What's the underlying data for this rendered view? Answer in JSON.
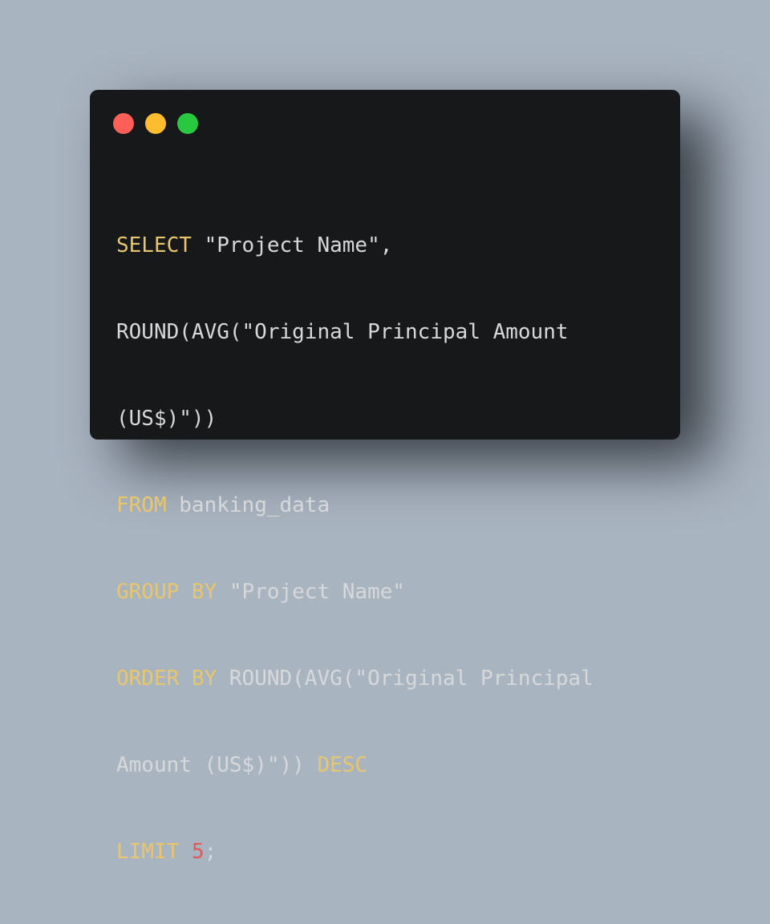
{
  "window": {
    "controls": [
      {
        "name": "close",
        "color": "#ff5f57"
      },
      {
        "name": "minimize",
        "color": "#febc2e"
      },
      {
        "name": "zoom",
        "color": "#28c840"
      }
    ]
  },
  "colors": {
    "background": "#a9b4c1",
    "window": "#17181a",
    "keyword": "#e8c66c",
    "number": "#e05a5a",
    "text": "#d7d8da"
  },
  "code": {
    "line1": {
      "kw": "SELECT",
      "rest": " \"Project Name\","
    },
    "line2": {
      "text": "ROUND(AVG(\"Original Principal Amount"
    },
    "line3": {
      "text": "(US$)\"))"
    },
    "line4": {
      "kw": "FROM",
      "rest": " banking_data"
    },
    "line5": {
      "kw": "GROUP BY",
      "rest": " \"Project Name\""
    },
    "line6": {
      "kw": "ORDER BY",
      "rest": " ROUND(AVG(\"Original Principal"
    },
    "line7": {
      "text": "Amount (US$)\")) ",
      "kw": "DESC"
    },
    "line8": {
      "kw": "LIMIT",
      "sp": " ",
      "num": "5",
      "end": ";"
    }
  }
}
